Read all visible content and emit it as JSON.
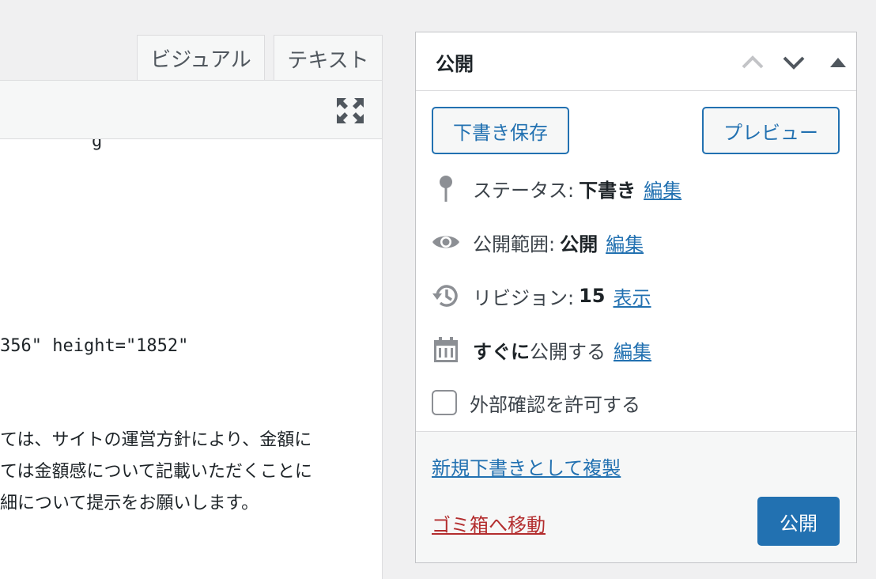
{
  "editor": {
    "tabs": [
      {
        "label": "ビジュアル"
      },
      {
        "label": "テキスト"
      }
    ],
    "fullscreen_icon": "fullscreen-icon",
    "lines": [
      "356\" height=\"1852\"",
      "ては、サイトの運営方針により、金額に",
      "ては金額感について記載いただくことに",
      "細について提示をお願いします。"
    ]
  },
  "publish": {
    "title": "公開",
    "save_draft_label": "下書き保存",
    "preview_label": "プレビュー",
    "status": {
      "label": "ステータス:",
      "value": "下書き",
      "edit": "編集",
      "icon": "pin-icon"
    },
    "visibility": {
      "label": "公開範囲:",
      "value": "公開",
      "edit": "編集",
      "icon": "eye-icon"
    },
    "revisions": {
      "label": "リビジョン:",
      "value": "15",
      "edit": "表示",
      "icon": "history-icon"
    },
    "schedule": {
      "value": "すぐに",
      "label": "公開する",
      "edit": "編集",
      "icon": "calendar-icon"
    },
    "allow_preview_label": "外部確認を許可する",
    "duplicate_label": "新規下書きとして複製",
    "trash_label": "ゴミ箱へ移動",
    "publish_label": "公開"
  },
  "colors": {
    "accent": "#2271b1",
    "danger": "#b32d2e",
    "background": "#f0f0f1"
  }
}
